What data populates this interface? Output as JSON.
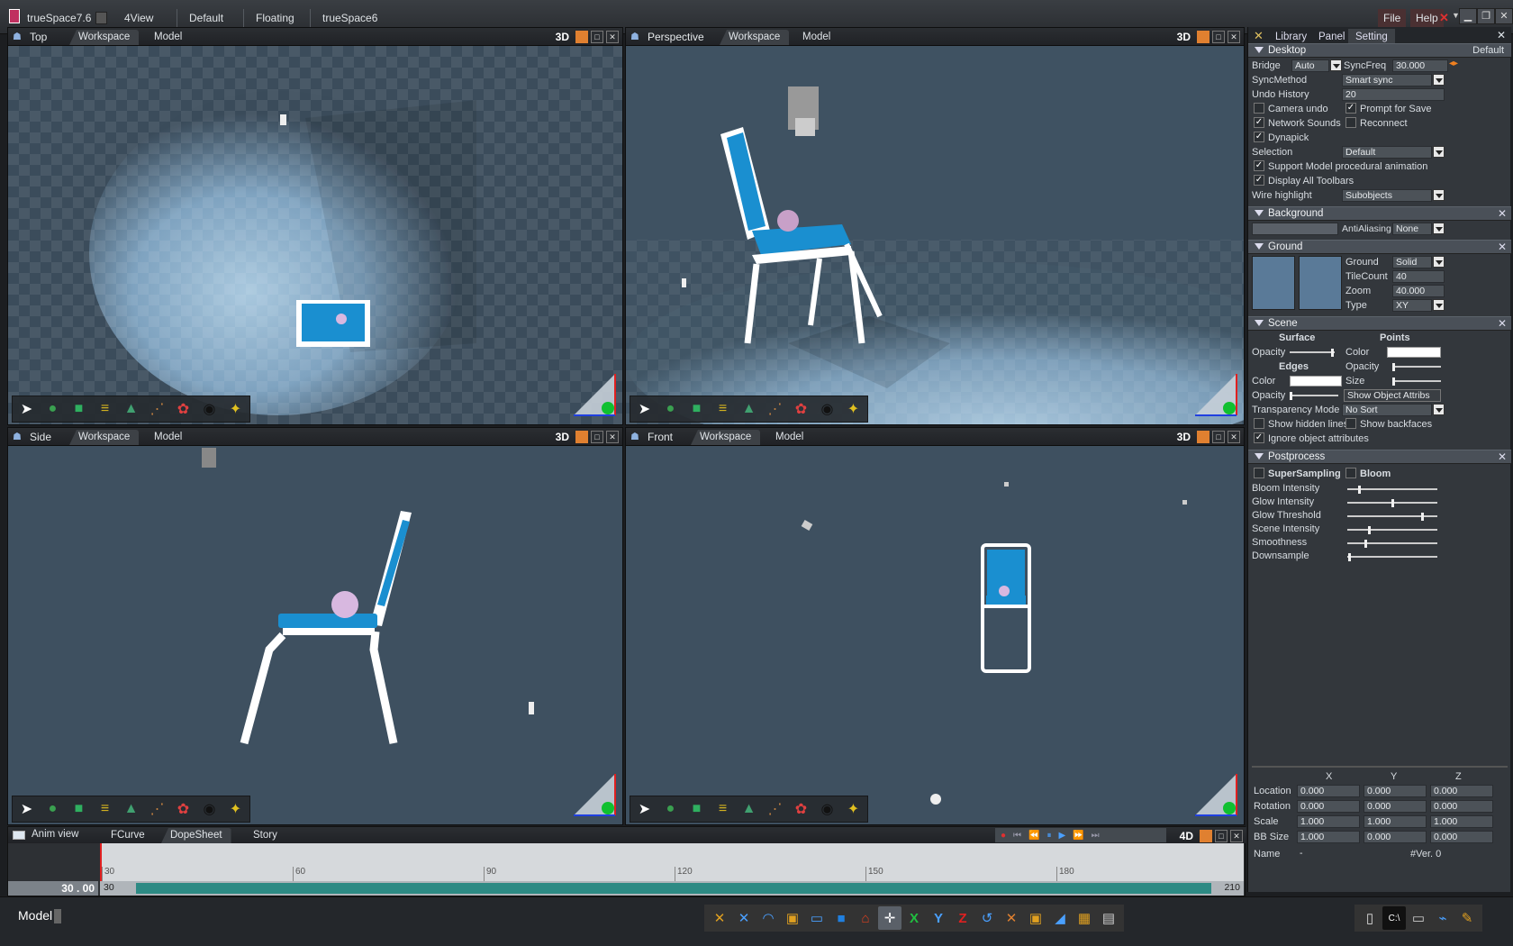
{
  "titlebar": {
    "app_title": "trueSpace7.6",
    "menu": [
      "4View",
      "Default",
      "Floating",
      "trueSpace6"
    ],
    "file": "File",
    "help": "Help"
  },
  "viewports": {
    "top": {
      "name": "Top",
      "tabs": [
        "Workspace",
        "Model"
      ],
      "mode": "3D"
    },
    "perspective": {
      "name": "Perspective",
      "tabs": [
        "Workspace",
        "Model"
      ],
      "mode": "3D"
    },
    "side": {
      "name": "Side",
      "tabs": [
        "Workspace",
        "Model"
      ],
      "mode": "3D"
    },
    "front": {
      "name": "Front",
      "tabs": [
        "Workspace",
        "Model"
      ],
      "mode": "3D"
    }
  },
  "panel": {
    "tabs": [
      "Library",
      "Panel",
      "Setting"
    ],
    "desktop": {
      "title": "Desktop",
      "preset": "Default",
      "bridge_label": "Bridge",
      "bridge_value": "Auto",
      "syncfreq_label": "SyncFreq",
      "syncfreq_value": "30.000",
      "syncmethod_label": "SyncMethod",
      "syncmethod_value": "Smart sync",
      "undo_label": "Undo History",
      "undo_value": "20",
      "camera_undo": "Camera undo",
      "prompt_save": "Prompt for Save",
      "network_sounds": "Network Sounds",
      "reconnect": "Reconnect",
      "dynapick": "Dynapick",
      "selection_label": "Selection",
      "selection_value": "Default",
      "support_model": "Support Model procedural animation",
      "display_toolbars": "Display All Toolbars",
      "wire_label": "Wire highlight",
      "wire_value": "Subobjects"
    },
    "background": {
      "title": "Background",
      "aa_label": "AntiAliasing",
      "aa_value": "None"
    },
    "ground": {
      "title": "Ground",
      "ground_label": "Ground",
      "ground_value": "Solid",
      "tilecount_label": "TileCount",
      "tilecount_value": "40",
      "zoom_label": "Zoom",
      "zoom_value": "40.000",
      "type_label": "Type",
      "type_value": "XY"
    },
    "scene": {
      "title": "Scene",
      "surface": "Surface",
      "points": "Points",
      "opacity": "Opacity",
      "color": "Color",
      "edges": "Edges",
      "size": "Size",
      "show_obj_attr": "Show Object Attribs",
      "transp_label": "Transparency Mode",
      "transp_value": "No Sort",
      "show_hidden": "Show hidden lines",
      "show_backfaces": "Show backfaces",
      "ignore_attr": "Ignore object attributes"
    },
    "postprocess": {
      "title": "Postprocess",
      "supersampling": "SuperSampling",
      "bloom": "Bloom",
      "sliders": [
        {
          "label": "Bloom Intensity",
          "value": 0.12
        },
        {
          "label": "Glow Intensity",
          "value": 0.5
        },
        {
          "label": "Glow Threshold",
          "value": 0.85
        },
        {
          "label": "Scene Intensity",
          "value": 0.24
        },
        {
          "label": "Smoothness",
          "value": 0.2
        },
        {
          "label": "Downsample",
          "value": 0.01
        }
      ]
    },
    "transform": {
      "headers": [
        "X",
        "Y",
        "Z"
      ],
      "rows": [
        {
          "label": "Location",
          "values": [
            "0.000",
            "0.000",
            "0.000"
          ]
        },
        {
          "label": "Rotation",
          "values": [
            "0.000",
            "0.000",
            "0.000"
          ]
        },
        {
          "label": "Scale",
          "values": [
            "1.000",
            "1.000",
            "1.000"
          ]
        },
        {
          "label": "BB Size",
          "values": [
            "1.000",
            "0.000",
            "0.000"
          ]
        }
      ],
      "name_label": "Name",
      "name_value": "-",
      "version": "#Ver. 0"
    }
  },
  "anim": {
    "title": "Anim view",
    "tabs": [
      "FCurve",
      "DopeSheet",
      "Story"
    ],
    "mode": "4D",
    "current_frame": "30 . 00",
    "start_frame": "30",
    "end_frame": "210",
    "ruler_start": "30",
    "ruler_ticks": [
      "60",
      "90",
      "120",
      "150",
      "180"
    ]
  },
  "status": {
    "mode": "Model"
  }
}
